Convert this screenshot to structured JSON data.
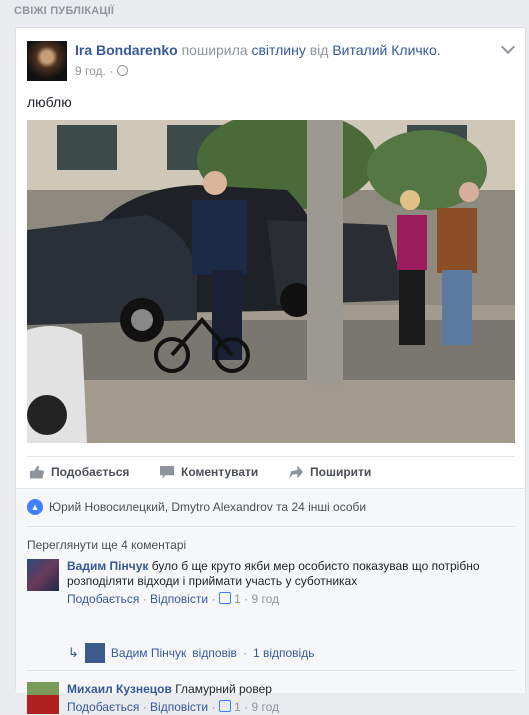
{
  "section_title": "СВІЖІ ПУБЛІКАЦІЇ",
  "post": {
    "author": "Ira Bondarenko",
    "verb": " поширила ",
    "object": "світлину",
    "from": " від ",
    "source": "Виталий Кличко.",
    "time": "9 год. ·",
    "text": "люблю"
  },
  "actions": {
    "like": "Подобається",
    "comment": "Коментувати",
    "share": "Поширити"
  },
  "likes_summary": "Юрий Новосилецкий, Dmytro Alexandrov та 24 інші особи",
  "more_comments": "Переглянути ще 4 коментарі",
  "comments": [
    {
      "author": "Вадим Пінчук",
      "text": " було б ще круто якби мер особисто показував що потрібно розподіляти відходи і приймати участь у суботниках",
      "like_label": "Подобається",
      "reply_label": "Відповісти",
      "likes": "1",
      "time": "9 год"
    },
    {
      "author": "Михаил Кузнецов",
      "text": " Гламурний ровер",
      "like_label": "Подобається",
      "reply_label": "Відповісти",
      "likes": "1",
      "time": "9 год"
    }
  ],
  "reply": {
    "author": "Вадим Пінчук",
    "verb": "відповів",
    "count": "1 відповідь"
  },
  "icons": [
    "globe-icon",
    "chevron-down-icon",
    "like-icon",
    "comment-icon",
    "share-icon",
    "reply-arrow-icon"
  ]
}
